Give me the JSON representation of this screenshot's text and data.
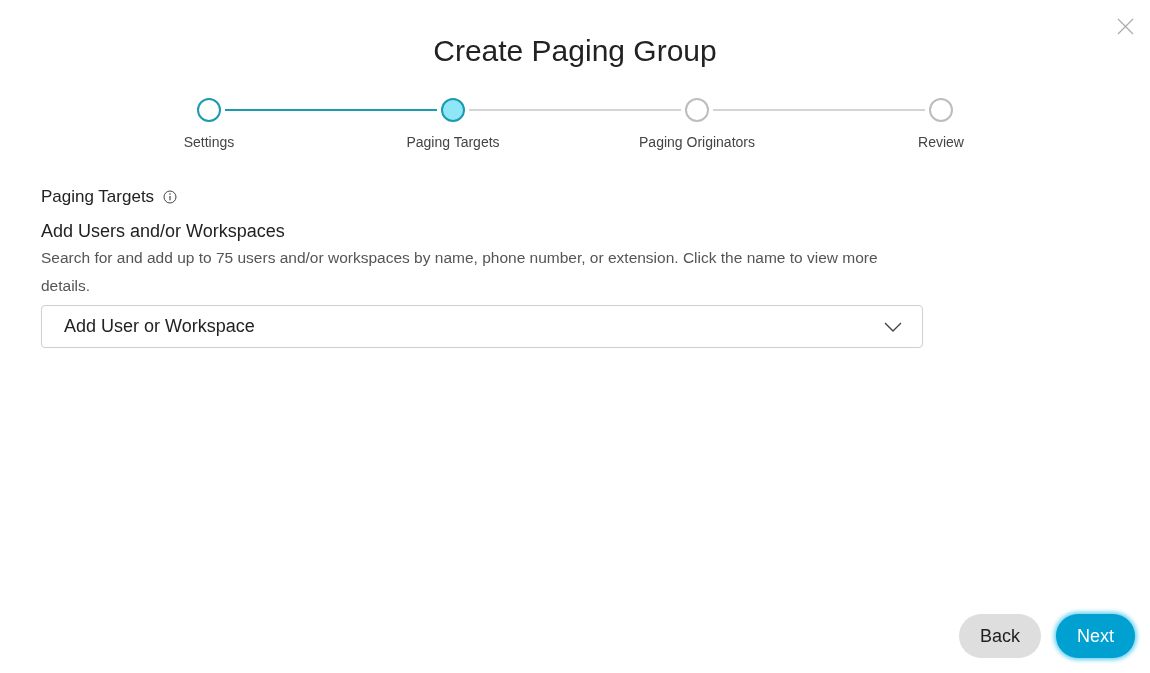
{
  "dialog": {
    "title": "Create Paging Group"
  },
  "steps": [
    {
      "label": "Settings",
      "completed": true,
      "selected": false
    },
    {
      "label": "Paging Targets",
      "completed": false,
      "selected": true
    },
    {
      "label": "Paging Originators",
      "completed": false,
      "selected": false
    },
    {
      "label": "Review",
      "completed": false,
      "selected": false
    }
  ],
  "section": {
    "title": "Paging Targets",
    "heading": "Add Users and/or Workspaces",
    "description": "Search for and add up to 75 users and/or workspaces by name, phone number, or extension. Click the name to view more details.",
    "dropdown": {
      "placeholder": "Add User or Workspace"
    }
  },
  "buttons": [
    {
      "label": "Back",
      "kind": "secondary"
    },
    {
      "label": "Next",
      "kind": "primary"
    }
  ]
}
